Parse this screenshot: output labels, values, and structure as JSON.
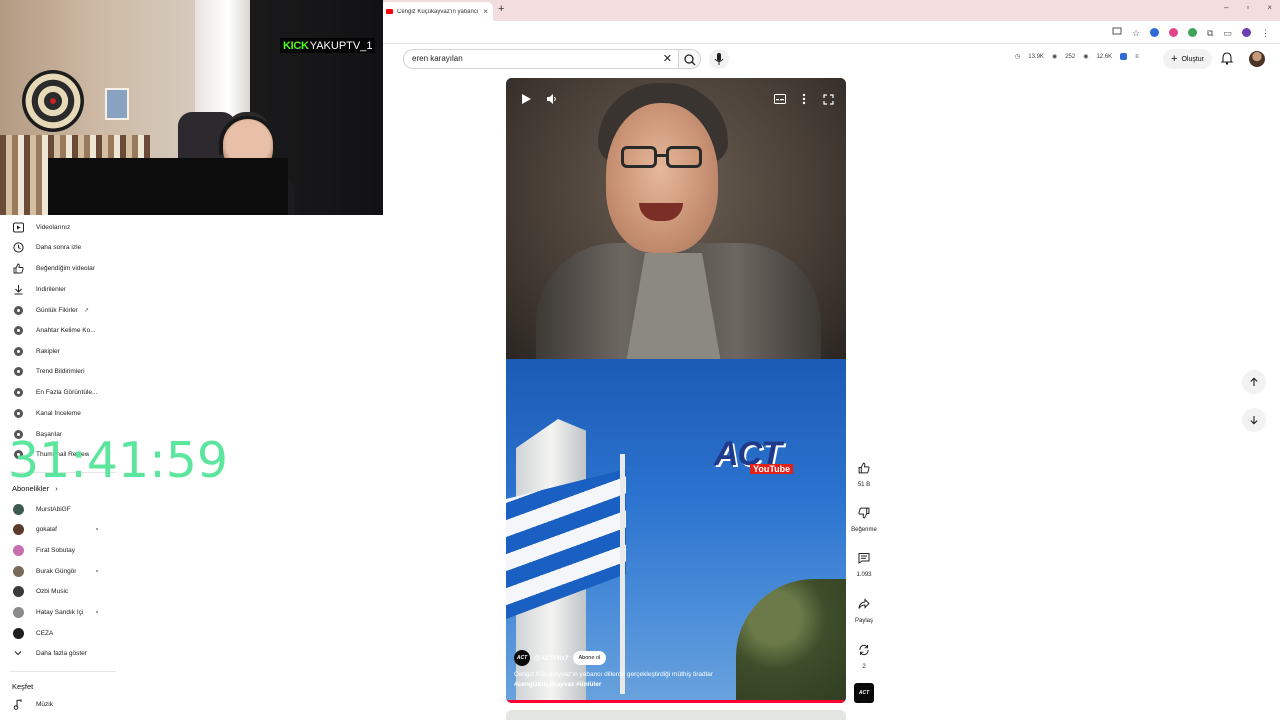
{
  "browser": {
    "tab_title": "Cengiz Küçükayvaz'ın yabancı",
    "tab_close": "×",
    "new_tab": "+",
    "window_controls": [
      "–",
      "▫",
      "×"
    ]
  },
  "header": {
    "search_query": "eren karayılan",
    "stats": [
      "13.9K",
      "252",
      "12.6K"
    ],
    "create_label": "Oluştur"
  },
  "webcam": {
    "kick_logo": "KICK",
    "channel": "YAKUPTV_1"
  },
  "timer": "31:41:59",
  "sidebar": {
    "items": [
      {
        "label": "Videolarınız",
        "icon": "play-square-icon"
      },
      {
        "label": "Daha sonra izle",
        "icon": "clock-icon"
      },
      {
        "label": "Beğendiğim videolar",
        "icon": "thumb-up-icon"
      },
      {
        "label": "İndirilenler",
        "icon": "download-icon"
      },
      {
        "label": "Günlük Fikirler",
        "icon": "extension-icon"
      },
      {
        "label": "Anahtar Kelime Ko...",
        "icon": "extension-icon"
      },
      {
        "label": "Rakipler",
        "icon": "extension-icon"
      },
      {
        "label": "Trend Bildirimleri",
        "icon": "extension-icon"
      },
      {
        "label": "En Fazla Görüntüle...",
        "icon": "extension-icon"
      },
      {
        "label": "Kanal İnceleme",
        "icon": "extension-icon"
      },
      {
        "label": "Başarılar",
        "icon": "extension-icon"
      },
      {
        "label": "Thumbnail Review",
        "icon": "extension-icon"
      }
    ],
    "subscriptions_title": "Abonelikler",
    "subscriptions": [
      {
        "name": "MurstAbiGF",
        "color": "#3f5a52",
        "dot": false
      },
      {
        "name": "gokalaf",
        "color": "#5a3a2a",
        "dot": true
      },
      {
        "name": "Fırat Sobutay",
        "color": "#c86fb0",
        "dot": false
      },
      {
        "name": "Burak Güngör",
        "color": "#7a6a5a",
        "dot": true
      },
      {
        "name": "Ozbi Music",
        "color": "#3a3a3a",
        "dot": false
      },
      {
        "name": "Hatay Sandık İçi",
        "color": "#8a8a8a",
        "dot": true
      },
      {
        "name": "CEZA",
        "color": "#1e1e1e",
        "dot": false
      }
    ],
    "show_more": "Daha fazla göster",
    "explore_title": "Keşfet",
    "explore_items": [
      {
        "label": "Müzik",
        "icon": "music-note-icon"
      }
    ]
  },
  "player": {
    "channel_avatar": "ACT",
    "channel_handle": "@ACTFlix7",
    "subscribe_label": "Abone ol",
    "caption": "Cengiz Küçükayvaz'ın yabancı dillerde gerçekleştirdiği müthiş tiradlar",
    "hashtags": "#cengizküçükayvaz #ünlüler",
    "overlay_logo": "ACT",
    "overlay_logo_sub": "YouTube",
    "progress": 1.0
  },
  "actions": {
    "like_count": "51 B",
    "dislike_label": "Beğenme",
    "comment_count": "1.093",
    "share_label": "Paylaş",
    "remix_count": "2",
    "mini_channel": "ACT"
  },
  "colors": {
    "accent_red": "#ff0033",
    "timer_green": "#5ce69d",
    "kick_green": "#53fc18"
  }
}
